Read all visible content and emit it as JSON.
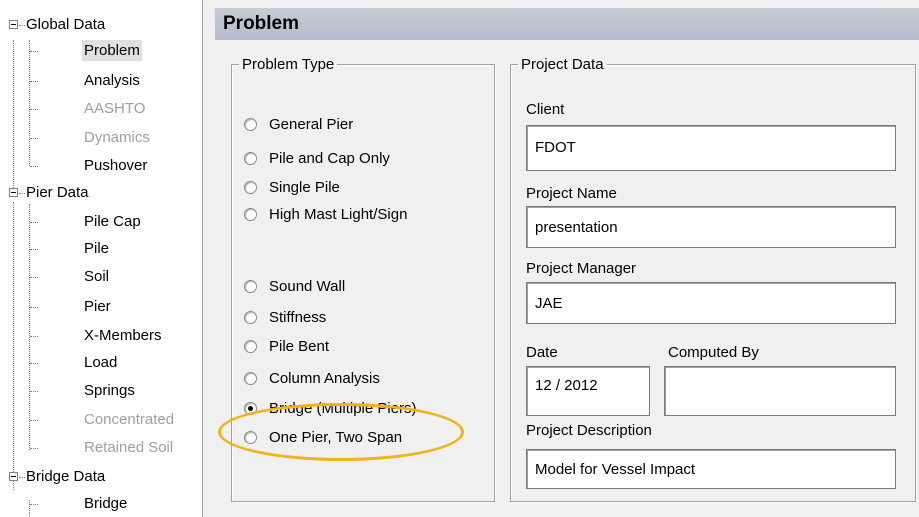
{
  "tree": {
    "global_data": "Global Data",
    "problem": "Problem",
    "analysis": "Analysis",
    "aashto": "AASHTO",
    "dynamics": "Dynamics",
    "pushover": "Pushover",
    "pier_data": "Pier Data",
    "pile_cap": "Pile Cap",
    "pile": "Pile",
    "soil": "Soil",
    "pier": "Pier",
    "x_members": "X-Members",
    "load": "Load",
    "springs": "Springs",
    "concentrated": "Concentrated",
    "retained_soil": "Retained Soil",
    "bridge_data": "Bridge Data",
    "bridge": "Bridge"
  },
  "header": {
    "title": "Problem"
  },
  "problem_type": {
    "legend": "Problem Type",
    "options": [
      "General Pier",
      "Pile and Cap Only",
      "Single Pile",
      "High Mast Light/Sign",
      "Sound Wall",
      "Stiffness",
      "Pile Bent",
      "Column Analysis",
      "Bridge (Multiple Piers)",
      "One Pier, Two Span"
    ],
    "selected": "Bridge (Multiple Piers)"
  },
  "project_data": {
    "legend": "Project Data",
    "client_label": "Client",
    "client_value": "FDOT",
    "project_name_label": "Project Name",
    "project_name_value": "presentation",
    "project_manager_label": "Project Manager",
    "project_manager_value": "JAE",
    "date_label": "Date",
    "date_value": "12 / 2012",
    "computed_by_label": "Computed By",
    "computed_by_value": "",
    "description_label": "Project Description",
    "description_value": "Model for Vessel Impact"
  },
  "colors": {
    "highlight": "#f1b315",
    "title_bar": "#bfc8d3",
    "disabled_text": "#a0a0a0"
  }
}
